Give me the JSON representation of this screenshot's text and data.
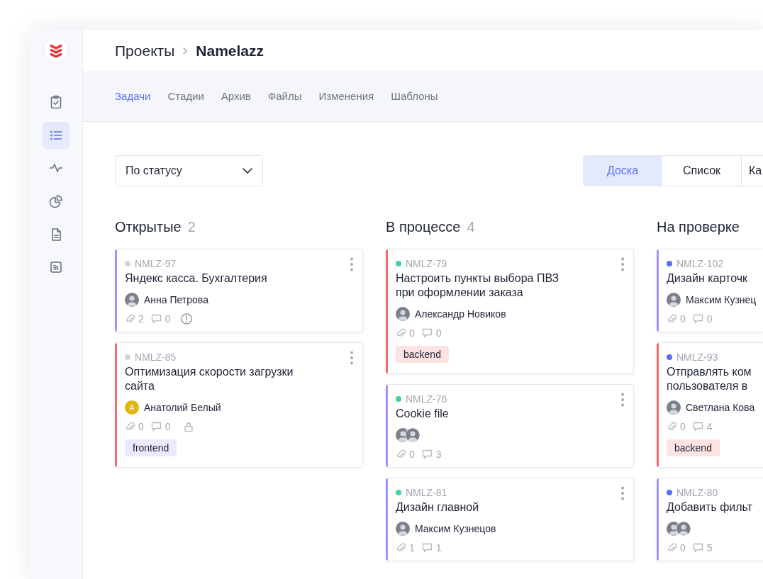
{
  "sidebar": {
    "items": [
      {
        "kind": "tasks",
        "selected": false
      },
      {
        "kind": "list",
        "selected": true
      },
      {
        "kind": "activity",
        "selected": false
      },
      {
        "kind": "charts",
        "selected": false
      },
      {
        "kind": "docs",
        "selected": false
      },
      {
        "kind": "feed",
        "selected": false
      }
    ]
  },
  "breadcrumb": [
    {
      "label": "Проекты",
      "current": false
    },
    {
      "label": "Namelazz",
      "current": true
    }
  ],
  "tabs": [
    {
      "label": "Задачи",
      "selected": true
    },
    {
      "label": "Стадии",
      "selected": false
    },
    {
      "label": "Архив",
      "selected": false
    },
    {
      "label": "Файлы",
      "selected": false
    },
    {
      "label": "Изменения",
      "selected": false
    },
    {
      "label": "Шаблоны",
      "selected": false
    }
  ],
  "filter": {
    "value": "По статусу"
  },
  "views": [
    {
      "label": "Доска",
      "selected": true
    },
    {
      "label": "Список",
      "selected": false
    },
    {
      "label": "Ка",
      "selected": false
    }
  ],
  "columns": [
    {
      "title": "Открытые",
      "count": "2",
      "clipped": false,
      "cards": [
        {
          "id": "NMLZ-97",
          "status_dot": {
            "color": "#d4d4d8"
          },
          "side_stripe": {
            "color": "#a394f7"
          },
          "title": "Яндекс касса. Бухгалтерия",
          "avatars": [
            {
              "kind": "photo"
            }
          ],
          "assignee": "Анна Петрова",
          "attachments": "2",
          "comments": "0",
          "warning": true,
          "locked": false
        },
        {
          "id": "NMLZ-85",
          "status_dot": {
            "color": "#d4d4d8"
          },
          "side_stripe": {
            "color": "#f46b6b"
          },
          "title": "Оптимизация скорости загрузки сайта",
          "avatars": [
            {
              "kind": "initials",
              "initial": "А"
            }
          ],
          "assignee": "Анатолий Белый",
          "attachments": "0",
          "comments": "0",
          "warning": false,
          "locked": true,
          "tags": [
            {
              "label": "frontend",
              "color": "#ece8fd"
            }
          ]
        }
      ]
    },
    {
      "title": "В процессе",
      "count": "4",
      "clipped": false,
      "cards": [
        {
          "id": "NMLZ-79",
          "status_dot": {
            "color": "#3fd3a5"
          },
          "side_stripe": {
            "color": "#f46b6b"
          },
          "title": "Настроить пункты выбора ПВЗ при оформлении заказа",
          "avatars": [
            {
              "kind": "photo"
            }
          ],
          "assignee": "Александр Новиков",
          "attachments": "0",
          "comments": "0",
          "warning": false,
          "locked": false,
          "tags": [
            {
              "label": "backend",
              "color": "#fde3e1"
            }
          ]
        },
        {
          "id": "NMLZ-76",
          "status_dot": {
            "color": "#3fd3a5"
          },
          "side_stripe": {
            "color": "#a394f7"
          },
          "title": "Cookie file",
          "avatars": [
            {
              "kind": "photo"
            },
            {
              "kind": "photo"
            }
          ],
          "attachments": "0",
          "comments": "3",
          "warning": false,
          "locked": false
        },
        {
          "id": "NMLZ-81",
          "status_dot": {
            "color": "#3fd3a5"
          },
          "side_stripe": {
            "color": "#a394f7"
          },
          "title": "Дизайн главной",
          "avatars": [
            {
              "kind": "photo"
            }
          ],
          "assignee": "Максим Кузнецов",
          "attachments": "1",
          "comments": "1",
          "warning": false,
          "locked": false
        }
      ]
    },
    {
      "title": "На проверке",
      "clipped": true,
      "cards": [
        {
          "id": "NMLZ-102",
          "status_dot": {
            "color": "#5b6cf0"
          },
          "side_stripe": {
            "color": "#a394f7"
          },
          "title": "Дизайн карточк",
          "avatars": [
            {
              "kind": "photo"
            }
          ],
          "assignee": "Максим Кузнец",
          "attachments": "0",
          "comments": "0",
          "warning": false,
          "locked": false
        },
        {
          "id": "NMLZ-93",
          "status_dot": {
            "color": "#5b6cf0"
          },
          "side_stripe": {
            "color": "#f46b6b"
          },
          "title": "Отправлять ком пользователя в",
          "avatars": [
            {
              "kind": "photo"
            }
          ],
          "assignee": "Светлана Кова",
          "attachments": "0",
          "comments": "4",
          "warning": false,
          "locked": false,
          "tags": [
            {
              "label": "backend",
              "color": "#fde3e1"
            }
          ]
        },
        {
          "id": "NMLZ-80",
          "status_dot": {
            "color": "#5b6cf0"
          },
          "side_stripe": {
            "color": "#a394f7"
          },
          "title": "Добавить фильт",
          "avatars": [
            {
              "kind": "photo"
            },
            {
              "kind": "photo"
            }
          ],
          "attachments": "0",
          "comments": "5",
          "warning": false,
          "locked": false
        }
      ]
    }
  ]
}
